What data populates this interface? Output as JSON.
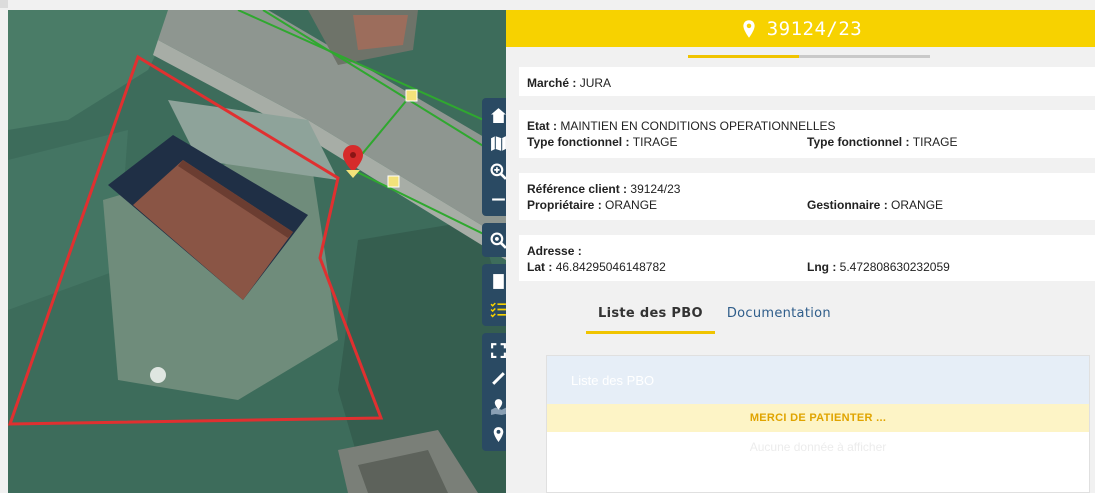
{
  "panel": {
    "title": "39124/23",
    "progress_fraction": 0.46,
    "marche": {
      "label": "Marché :",
      "value": "JURA"
    },
    "etat": {
      "label": "Etat :",
      "value": "MAINTIEN EN CONDITIONS OPERATIONNELLES"
    },
    "type_fonctionnel_1": {
      "label": "Type fonctionnel :",
      "value": "TIRAGE"
    },
    "type_fonctionnel_2": {
      "label": "Type fonctionnel :",
      "value": "TIRAGE"
    },
    "reference_client": {
      "label": "Référence client :",
      "value": "39124/23"
    },
    "proprietaire": {
      "label": "Propriétaire :",
      "value": "ORANGE"
    },
    "gestionnaire": {
      "label": "Gestionnaire :",
      "value": "ORANGE"
    },
    "adresse": {
      "label": "Adresse :",
      "value": ""
    },
    "lat": {
      "label": "Lat :",
      "value": "46.84295046148782"
    },
    "lng": {
      "label": "Lng :",
      "value": "5.472808630232059"
    },
    "tabs": [
      {
        "label": "Liste des PBO",
        "active": true
      },
      {
        "label": "Documentation",
        "active": false
      }
    ],
    "pbo": {
      "header": "Liste des PBO",
      "loading": "MERCI DE PATIENTER ...",
      "empty": "Aucune donnée à afficher"
    }
  },
  "map_toolbar": {
    "groups": [
      [
        "home-icon",
        "map-layers-icon",
        "zoom-in-icon",
        "zoom-out-icon"
      ],
      [
        "zoom-search-icon"
      ],
      [
        "sheet-icon",
        "checklist-icon"
      ],
      [
        "fullscreen-icon",
        "ruler-icon",
        "map-pin-layer-icon",
        "location-icon"
      ]
    ]
  },
  "colors": {
    "accent_yellow": "#f7d200",
    "toolbar_bg": "#2a4a63",
    "parcel_outline": "#e03030",
    "cable_line": "#2fa82f",
    "tab_link": "#2f5d8a",
    "loading_text": "#e0a400"
  }
}
